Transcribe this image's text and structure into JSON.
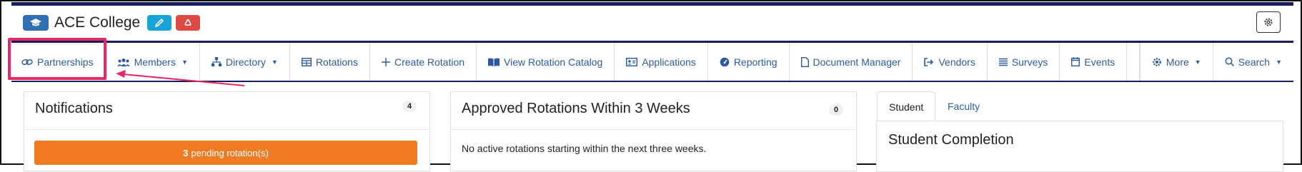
{
  "header": {
    "college_name": "ACE College",
    "icons": {
      "logo": "graduation-cap-icon",
      "edit": "pencil-icon",
      "recycle": "recycle-icon",
      "settings": "gear-icon"
    }
  },
  "nav": {
    "partnerships": "Partnerships",
    "members": "Members",
    "directory": "Directory",
    "rotations": "Rotations",
    "create_rotation": "Create Rotation",
    "view_rotation_catalog": "View Rotation Catalog",
    "applications": "Applications",
    "reporting": "Reporting",
    "document_manager": "Document Manager",
    "vendors": "Vendors",
    "surveys": "Surveys",
    "events": "Events",
    "more": "More",
    "search": "Search"
  },
  "notifications": {
    "title": "Notifications",
    "count": "4",
    "pending_count": "3",
    "pending_label": "pending rotation(s)"
  },
  "approved": {
    "title": "Approved Rotations Within 3 Weeks",
    "count": "0",
    "empty_message": "No active rotations starting within the next three weeks."
  },
  "completion": {
    "tabs": [
      "Student",
      "Faculty"
    ],
    "title": "Student Completion"
  },
  "colors": {
    "nav_text": "#2c5aa0",
    "nav_border": "#1a1a5e",
    "highlight": "#e32a63",
    "pending": "#f07b22",
    "edit": "#17a2d8",
    "recycle": "#dc4a43",
    "logo_badge": "#2f6fb3"
  }
}
